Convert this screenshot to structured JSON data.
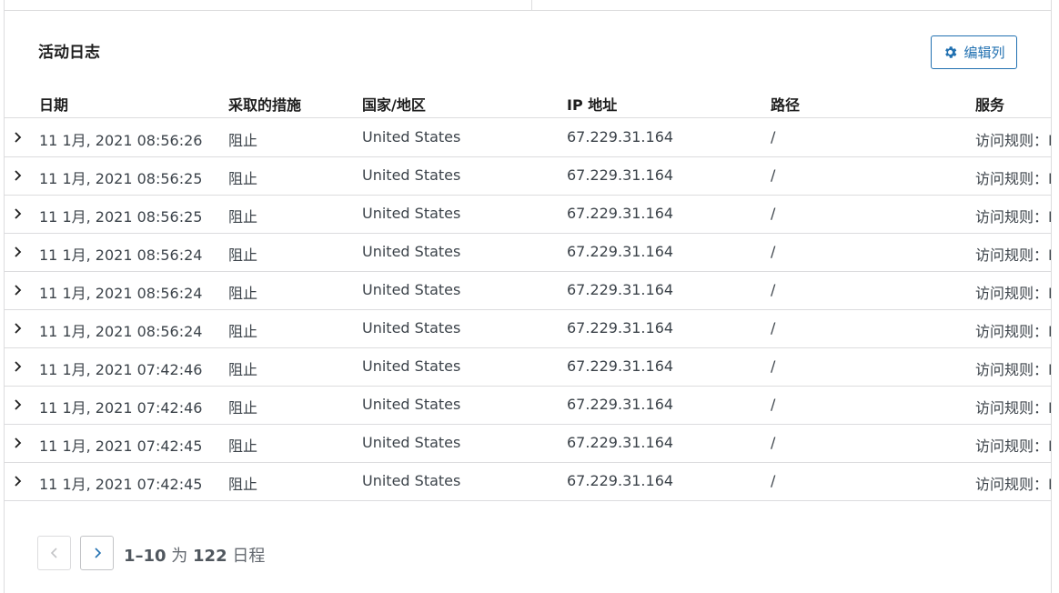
{
  "panel": {
    "title": "活动日志",
    "edit_columns_label": "编辑列",
    "edit_icon": "gear-icon"
  },
  "table": {
    "columns": [
      "日期",
      "采取的措施",
      "国家/地区",
      "IP 地址",
      "路径",
      "服务"
    ],
    "rows": [
      {
        "date": "11 1月, 2021 08:56:26",
        "action": "阻止",
        "country": "United States",
        "ip": "67.229.31.164",
        "path": "/",
        "service": "访问规则：I"
      },
      {
        "date": "11 1月, 2021 08:56:25",
        "action": "阻止",
        "country": "United States",
        "ip": "67.229.31.164",
        "path": "/",
        "service": "访问规则：I"
      },
      {
        "date": "11 1月, 2021 08:56:25",
        "action": "阻止",
        "country": "United States",
        "ip": "67.229.31.164",
        "path": "/",
        "service": "访问规则：I"
      },
      {
        "date": "11 1月, 2021 08:56:24",
        "action": "阻止",
        "country": "United States",
        "ip": "67.229.31.164",
        "path": "/",
        "service": "访问规则：I"
      },
      {
        "date": "11 1月, 2021 08:56:24",
        "action": "阻止",
        "country": "United States",
        "ip": "67.229.31.164",
        "path": "/",
        "service": "访问规则：I"
      },
      {
        "date": "11 1月, 2021 08:56:24",
        "action": "阻止",
        "country": "United States",
        "ip": "67.229.31.164",
        "path": "/",
        "service": "访问规则：I"
      },
      {
        "date": "11 1月, 2021 07:42:46",
        "action": "阻止",
        "country": "United States",
        "ip": "67.229.31.164",
        "path": "/",
        "service": "访问规则：I"
      },
      {
        "date": "11 1月, 2021 07:42:46",
        "action": "阻止",
        "country": "United States",
        "ip": "67.229.31.164",
        "path": "/",
        "service": "访问规则：I"
      },
      {
        "date": "11 1月, 2021 07:42:45",
        "action": "阻止",
        "country": "United States",
        "ip": "67.229.31.164",
        "path": "/",
        "service": "访问规则：I"
      },
      {
        "date": "11 1月, 2021 07:42:45",
        "action": "阻止",
        "country": "United States",
        "ip": "67.229.31.164",
        "path": "/",
        "service": "访问规则：I"
      }
    ]
  },
  "pagination": {
    "range": "1–10",
    "separator": " 为 ",
    "total": "122",
    "unit": " 日程"
  },
  "colors": {
    "accent": "#2271b1",
    "border": "#dcdcde",
    "text": "#3c434a"
  }
}
